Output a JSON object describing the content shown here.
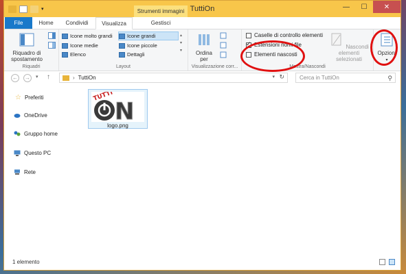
{
  "window": {
    "title": "TuttiOn",
    "contextual_tab_header": "Strumenti immagini",
    "controls": {
      "minimize": "—",
      "maximize": "☐",
      "close": "✕"
    }
  },
  "tabs": [
    {
      "label": "File"
    },
    {
      "label": "Home"
    },
    {
      "label": "Condividi"
    },
    {
      "label": "Visualizza"
    },
    {
      "label": "Gestisci"
    }
  ],
  "ribbon": {
    "panes": {
      "nav_pane_label": "Riquadro di spostamento",
      "group_label": "Riquadri"
    },
    "layout": {
      "group_label": "Layout",
      "options": [
        {
          "label": "Icone molto grandi"
        },
        {
          "label": "Icone grandi"
        },
        {
          "label": "Icone medie"
        },
        {
          "label": "Icone piccole"
        },
        {
          "label": "Elenco"
        },
        {
          "label": "Dettagli"
        }
      ],
      "active": "Icone grandi"
    },
    "current_view": {
      "sort_label": "Ordina per",
      "group_label": "Visualizzazione corr..."
    },
    "show_hide": {
      "checkboxes": [
        {
          "label": "Caselle di controllo elementi",
          "checked": false
        },
        {
          "label": "Estensioni nomi file",
          "checked": true
        },
        {
          "label": "Elementi nascosti",
          "checked": false
        }
      ],
      "hide_selected_label": "Nascondi elementi selezionati",
      "group_label": "Mostra/Nascondi"
    },
    "options_label": "Opzioni"
  },
  "address": {
    "path_segment": "TuttiOn",
    "search_placeholder": "Cerca in TuttiOn"
  },
  "nav": {
    "items": [
      {
        "label": "Preferiti",
        "icon": "star-icon"
      },
      {
        "label": "OneDrive",
        "icon": "cloud-icon"
      },
      {
        "label": "Gruppo home",
        "icon": "homegroup-icon"
      },
      {
        "label": "Questo PC",
        "icon": "computer-icon"
      },
      {
        "label": "Rete",
        "icon": "network-icon"
      }
    ]
  },
  "files": [
    {
      "name": "logo.png",
      "logo_text": "TUTTI ON"
    }
  ],
  "status": {
    "count": "1 elemento"
  },
  "colors": {
    "accent": "#1979ca",
    "titlebar": "#f8c64a",
    "highlight_ring": "#e01010"
  }
}
